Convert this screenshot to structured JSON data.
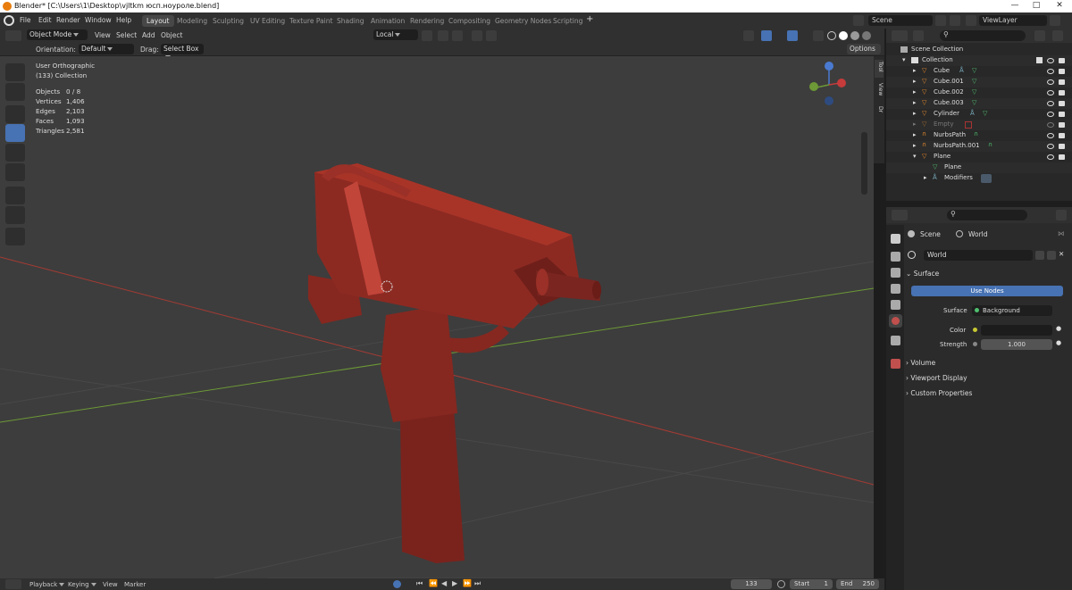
{
  "window": {
    "title": "Blender* [C:\\Users\\1\\Desktop\\vjltkm юсп.ноуроле.blend]"
  },
  "menu": [
    "File",
    "Edit",
    "Render",
    "Window",
    "Help"
  ],
  "workspaces": [
    "Layout",
    "Modeling",
    "Sculpting",
    "UV Editing",
    "Texture Paint",
    "Shading",
    "Animation",
    "Rendering",
    "Compositing",
    "Geometry Nodes",
    "Scripting"
  ],
  "active_workspace": "Layout",
  "scene": "Scene",
  "view_layer": "ViewLayer",
  "viewport_header": {
    "mode": "Object Mode",
    "menus": [
      "View",
      "Select",
      "Add",
      "Object"
    ],
    "transform": "Local"
  },
  "tool_header": {
    "orientation_label": "Orientation:",
    "orientation": "Default",
    "drag_label": "Drag:",
    "drag": "Select Box",
    "options": "Options"
  },
  "viewport_info": {
    "view": "User Orthographic",
    "collection": "(133) Collection"
  },
  "stats": [
    {
      "label": "Objects",
      "value": "0 / 8"
    },
    {
      "label": "Vertices",
      "value": "1,406"
    },
    {
      "label": "Edges",
      "value": "2,103"
    },
    {
      "label": "Faces",
      "value": "1,093"
    },
    {
      "label": "Triangles",
      "value": "2,581"
    }
  ],
  "side_tabs": [
    "Tool",
    "View",
    "Dr"
  ],
  "outliner": {
    "root": "Scene Collection",
    "collection": "Collection",
    "items": [
      "Cube",
      "Cube.001",
      "Cube.002",
      "Cube.003",
      "Cylinder",
      "Empty",
      "NurbsPath",
      "NurbsPath.001",
      "Plane",
      "Plane",
      "Modifiers"
    ]
  },
  "properties": {
    "breadcrumb_scene": "Scene",
    "breadcrumb_world": "World",
    "world_name": "World",
    "surface_panel": "Surface",
    "use_nodes": "Use Nodes",
    "surface_label": "Surface",
    "surface_value": "Background",
    "color_label": "Color",
    "strength_label": "Strength",
    "strength_value": "1.000",
    "panels": [
      "Volume",
      "Viewport Display",
      "Custom Properties"
    ]
  },
  "timeline": {
    "menus": [
      "Playback",
      "Keying",
      "View",
      "Marker"
    ],
    "current_frame": "133",
    "start_label": "Start",
    "start": "1",
    "end_label": "End",
    "end": "250"
  },
  "colors": {
    "accent": "#4772b3",
    "model": "#8c2a22",
    "x_axis": "#c0392b",
    "y_axis": "#7cae3a"
  }
}
